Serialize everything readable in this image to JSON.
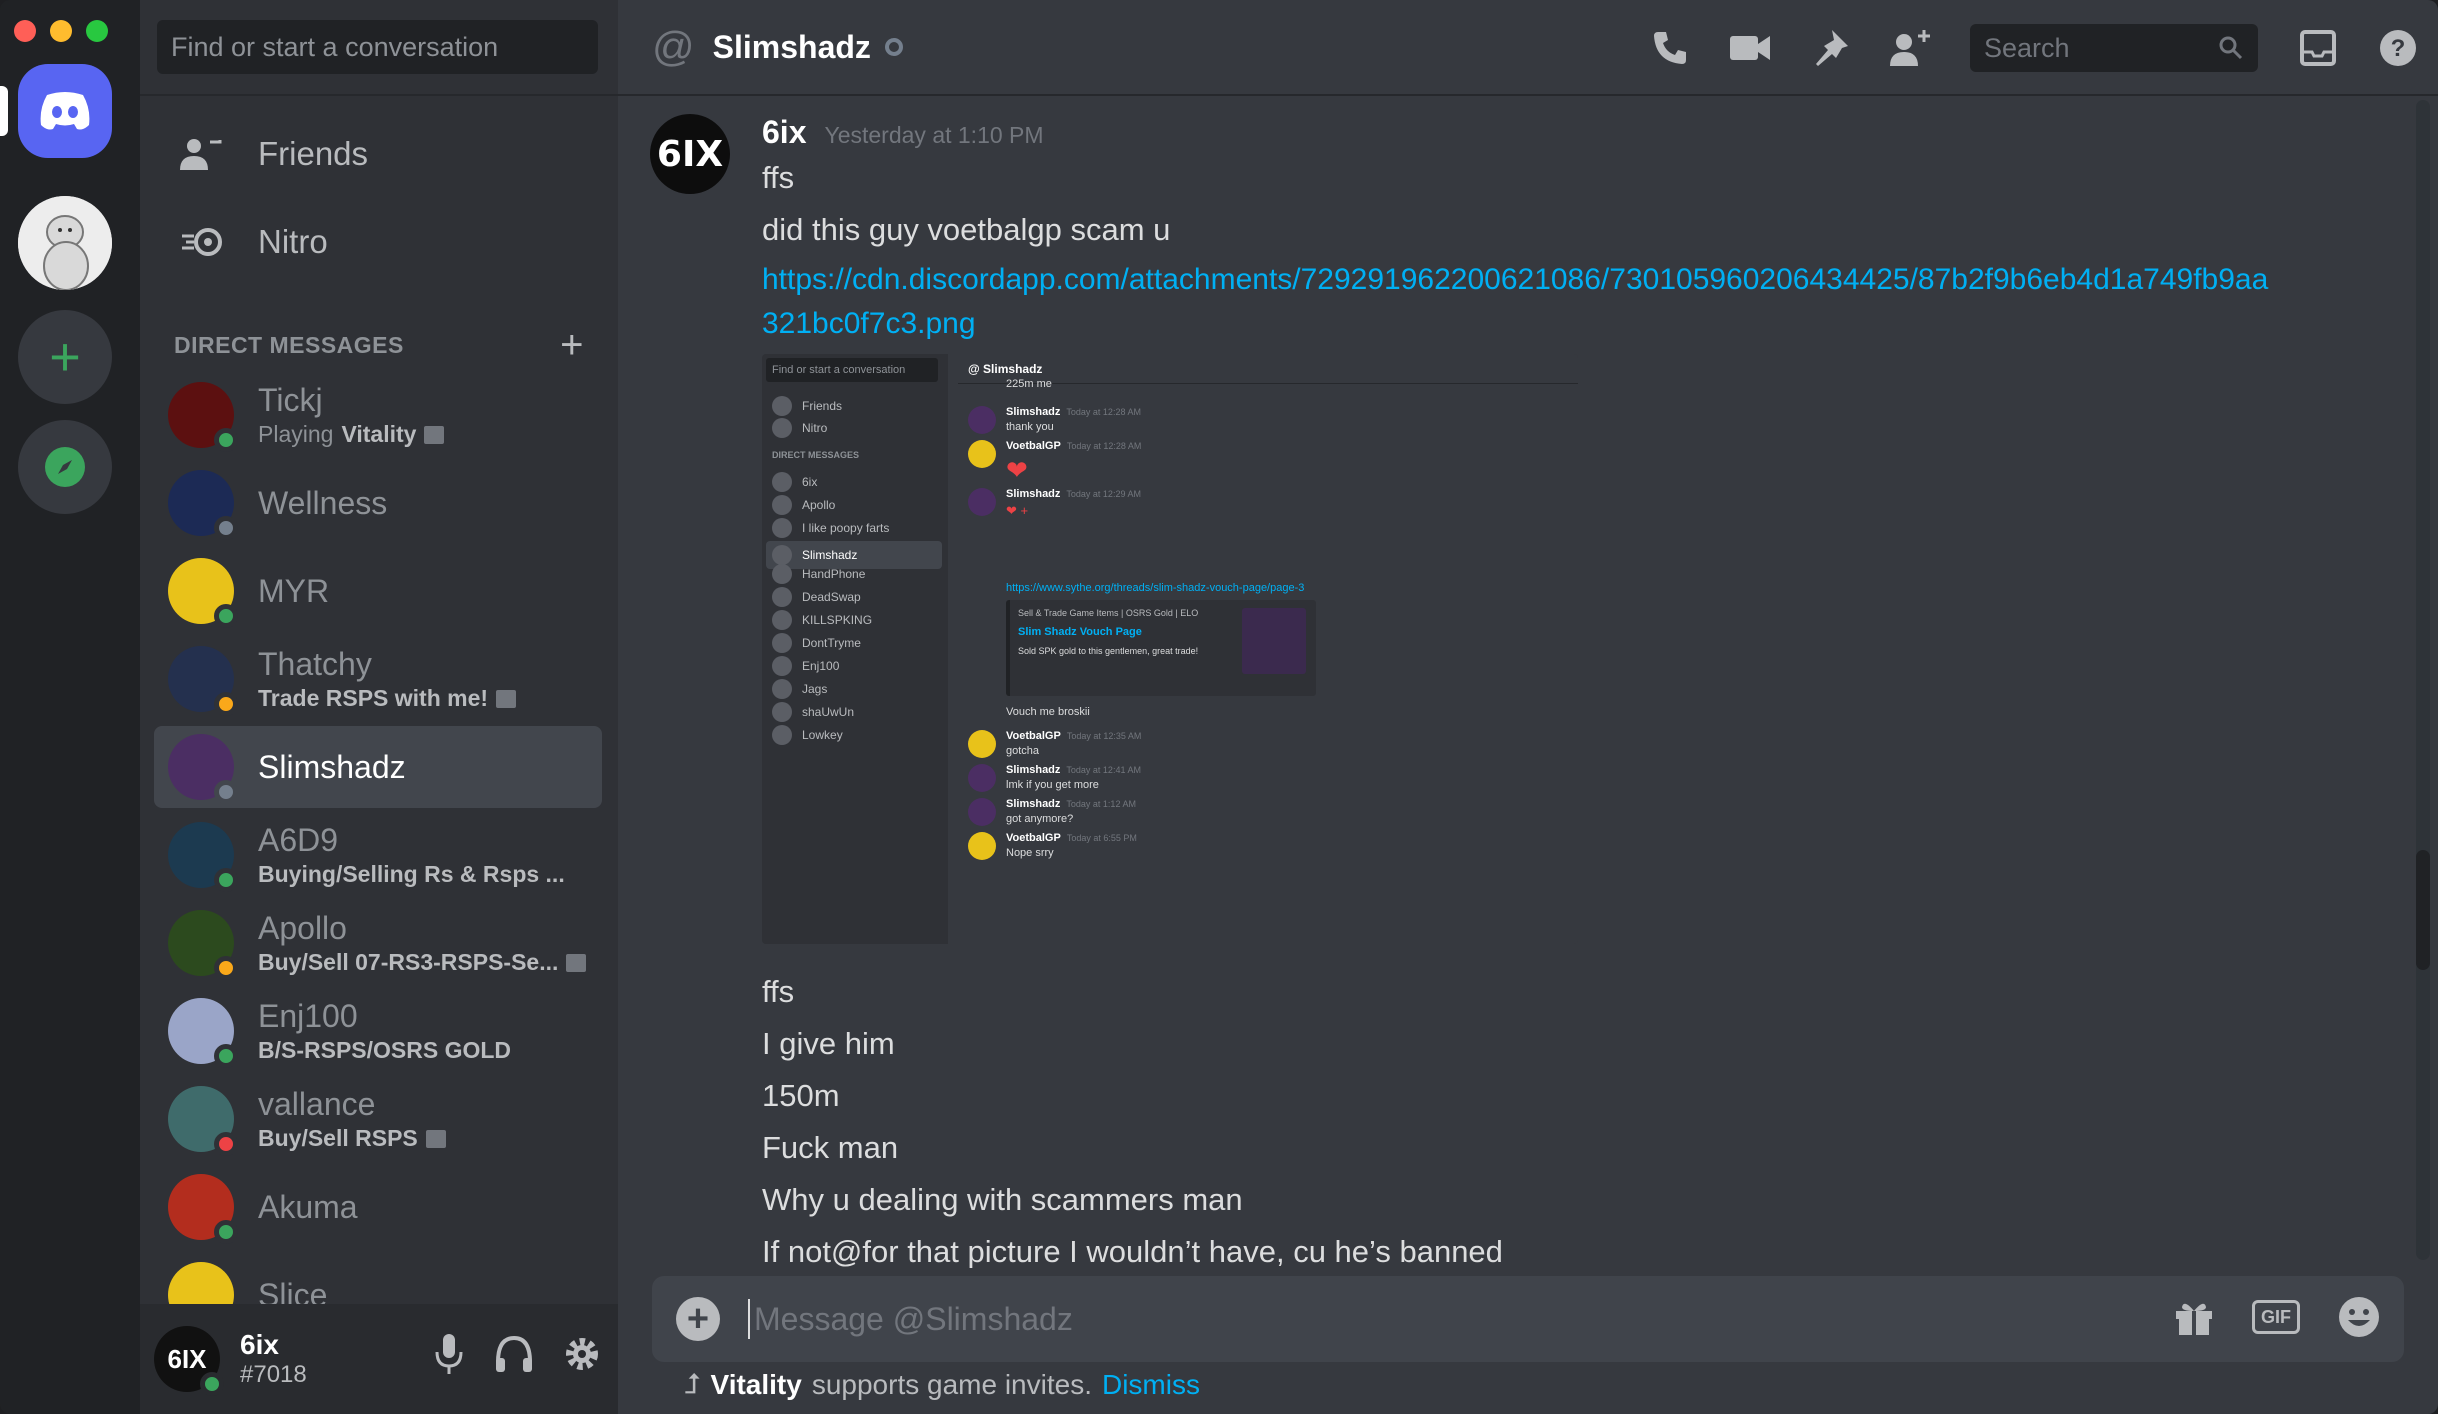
{
  "window": {
    "traffic_lights": [
      "#ff5f57",
      "#febc2e",
      "#28c840"
    ]
  },
  "servers": {
    "home_label": "Home",
    "add_label": "Add a Server",
    "explore_label": "Explore Public Servers"
  },
  "sidebar": {
    "search_placeholder": "Find or start a conversation",
    "nav": [
      {
        "label": "Friends",
        "icon": "friends-icon"
      },
      {
        "label": "Nitro",
        "icon": "nitro-icon"
      }
    ],
    "dm_header": "DIRECT MESSAGES",
    "dm_add": "+",
    "dms": [
      {
        "name": "Tickj",
        "activity_prefix": "Playing",
        "activity": "Vitality",
        "status": "online",
        "avatar_color": "#5c1010",
        "note": true
      },
      {
        "name": "Wellness",
        "activity_prefix": "",
        "activity": "",
        "status": "offline",
        "avatar_color": "#1c2a55",
        "note": false
      },
      {
        "name": "MYR",
        "activity_prefix": "",
        "activity": "",
        "status": "mobile",
        "avatar_color": "#e8c21a",
        "note": false
      },
      {
        "name": "Thatchy",
        "activity_prefix": "",
        "activity": "Trade RSPS with me!",
        "status": "idle",
        "avatar_color": "#24304e",
        "note": true
      },
      {
        "name": "Slimshadz",
        "activity_prefix": "",
        "activity": "",
        "status": "offline",
        "avatar_color": "#4b2e63",
        "note": false
      },
      {
        "name": "A6D9",
        "activity_prefix": "",
        "activity": "Buying/Selling Rs & Rsps ...",
        "status": "online",
        "avatar_color": "#1c3a50",
        "note": false
      },
      {
        "name": "Apollo",
        "activity_prefix": "",
        "activity": "Buy/Sell 07-RS3-RSPS-Se...",
        "status": "idle",
        "avatar_color": "#2c4a1e",
        "note": true
      },
      {
        "name": "Enj100",
        "activity_prefix": "",
        "activity": "B/S-RSPS/OSRS GOLD",
        "status": "online",
        "avatar_color": "#9aa5c8",
        "note": false
      },
      {
        "name": "vallance",
        "activity_prefix": "",
        "activity": "Buy/Sell RSPS",
        "status": "dnd",
        "avatar_color": "#3f6b6b",
        "note": true
      },
      {
        "name": "Akuma",
        "activity_prefix": "",
        "activity": "",
        "status": "online",
        "avatar_color": "#b32d1e",
        "note": false
      },
      {
        "name": "Slice",
        "activity_prefix": "",
        "activity": "",
        "status": "online",
        "avatar_color": "#e8c21a",
        "note": false
      }
    ],
    "user": {
      "name": "6ix",
      "tag": "#7018",
      "avatar_text": "6IX"
    }
  },
  "header": {
    "at": "@",
    "title": "Slimshadz",
    "search_placeholder": "Search"
  },
  "message": {
    "author": "6ix",
    "avatar_text": "6IX",
    "time": "Yesterday at 1:10 PM",
    "lines_top": [
      "ffs",
      "did this guy voetbalgp scam u"
    ],
    "link": "https://cdn.discordapp.com/attachments/729291962200621086/730105960206434425/87b2f9b6eb4d1a749fb9aa321bc0f7c3.png",
    "lines_bottom": [
      "ffs",
      "I give him",
      "150m",
      "Fuck man",
      "Why u dealing with scammers man",
      "If not@for that picture I wouldn’t have, cu he’s banned"
    ]
  },
  "attachment": {
    "find": "Find or start a conversation",
    "header": "Slimshadz",
    "nav": [
      "Friends",
      "Nitro"
    ],
    "dm_header": "DIRECT MESSAGES",
    "dms": [
      "6ix",
      "Apollo",
      "I like poopy farts",
      "Slimshadz",
      "HandPhone",
      "DeadSwap",
      "KILLSPKING",
      "DontTryme",
      "Enj100",
      "Jags",
      "shaUwUn",
      "Lowkey"
    ],
    "top_text": "225m me",
    "messages": [
      {
        "author": "Slimshadz",
        "time": "Today at 12:28 AM",
        "text": "thank you",
        "color": "#4b2e63"
      },
      {
        "author": "VoetbalGP",
        "time": "Today at 12:28 AM",
        "text": "❤",
        "color": "#e8c21a"
      },
      {
        "author": "Slimshadz",
        "time": "Today at 12:29 AM",
        "text": "❤ +",
        "color": "#4b2e63"
      },
      {
        "author": "VoetbalGP",
        "time": "Today at 12:35 AM",
        "text": "gotcha",
        "color": "#e8c21a"
      },
      {
        "author": "Slimshadz",
        "time": "Today at 12:41 AM",
        "text": "lmk if you get more",
        "color": "#4b2e63"
      },
      {
        "author": "Slimshadz",
        "time": "Today at 1:12 AM",
        "text": "got anymore?",
        "color": "#4b2e63"
      },
      {
        "author": "VoetbalGP",
        "time": "Today at 6:55 PM",
        "text": "Nope srry",
        "color": "#e8c21a"
      }
    ],
    "link": "https://www.sythe.org/threads/slim-shadz-vouch-page/page-3",
    "embed_provider": "Sell & Trade Game Items | OSRS Gold | ELO",
    "embed_title": "Slim Shadz Vouch Page",
    "embed_desc": "Sold SPK gold to this gentlemen, great trade!",
    "vouch": "Vouch me broskii"
  },
  "composer": {
    "placeholder": "Message @Slimshadz",
    "gif": "GIF"
  },
  "invite": {
    "game": "Vitality",
    "text": "supports game invites.",
    "dismiss": "Dismiss"
  },
  "colors": {
    "online": "#3ba55d",
    "idle": "#faa81a",
    "dnd": "#ed4245",
    "offline": "#747f8d",
    "link": "#00b0f4",
    "brand": "#5865f2"
  }
}
